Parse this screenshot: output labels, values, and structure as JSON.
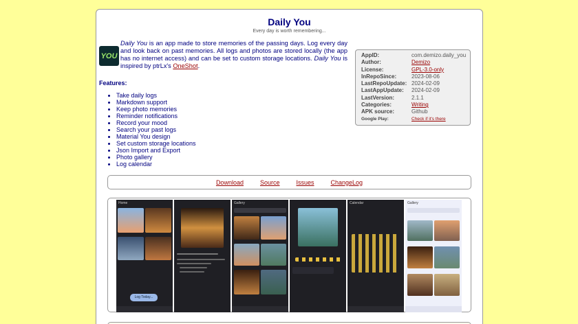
{
  "app": {
    "title": "Daily You",
    "tagline": "Every day is worth remembering...",
    "icon_text": "YOU"
  },
  "description": {
    "p1_italic": "Daily You",
    "p1_rest": " is an app made to store memories of the passing days. Log every day and look back on past memories. All logs and photos are stored locally (the app has no internet access) and can be set to custom storage locations. ",
    "p2_italic": "Daily You",
    "p2_rest": " is inspired by ptrLx's ",
    "link": "OneShot",
    "end": "."
  },
  "features": {
    "label": "Features:",
    "items": [
      "Take daily logs",
      "Markdown support",
      "Keep photo memories",
      "Reminder notifications",
      "Record your mood",
      "Search your past logs",
      "Material You design",
      "Set custom storage locations",
      "Json Import and Export",
      "Photo gallery",
      "Log calendar"
    ]
  },
  "info": {
    "rows": [
      {
        "k": "AppID:",
        "v": "com.demizo.daily_you",
        "link": false
      },
      {
        "k": "Author:",
        "v": "Demizo",
        "link": true
      },
      {
        "k": "License:",
        "v": "GPL-3.0-only",
        "link": true
      },
      {
        "k": "InRepoSince:",
        "v": "2023-08-06",
        "link": false
      },
      {
        "k": "LastRepoUpdate:",
        "v": "2024-02-09",
        "link": false
      },
      {
        "k": "LastAppUpdate:",
        "v": "2024-02-09",
        "link": false
      },
      {
        "k": "LastVersion:",
        "v": "2.1.1",
        "link": false
      },
      {
        "k": "Categories:",
        "v": "Writing",
        "link": true
      },
      {
        "k": "APK source:",
        "v": "Github",
        "link": false
      }
    ],
    "google_play_label": "Google Play:",
    "google_play_value": "Check if it's there"
  },
  "links": {
    "download": "Download",
    "source": "Source",
    "issues": "Issues",
    "changelog": "ChangeLog"
  },
  "screenshots": {
    "labels": [
      "Home",
      "",
      "Gallery",
      "",
      "Calendar",
      "Gallery"
    ],
    "home_button": "Log Today..."
  },
  "colors": {
    "background": "#ffff99",
    "text": "#000080",
    "link": "#990000"
  }
}
